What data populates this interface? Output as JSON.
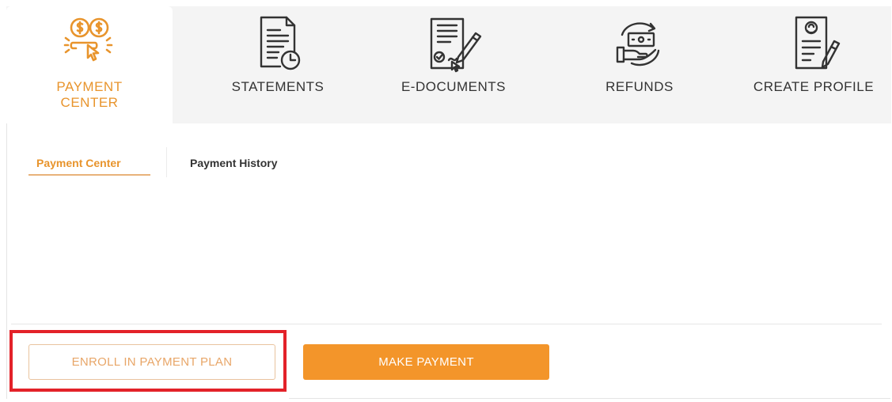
{
  "tabs": [
    {
      "id": "payment-center",
      "label_line1": "PAYMENT",
      "label_line2": "CENTER",
      "icon": "coin-hand-icon",
      "active": true
    },
    {
      "id": "statements",
      "label": "STATEMENTS",
      "icon": "document-clock-icon"
    },
    {
      "id": "e-documents",
      "label": "E-DOCUMENTS",
      "icon": "signed-document-icon"
    },
    {
      "id": "refunds",
      "label": "REFUNDS",
      "icon": "cash-hand-icon"
    },
    {
      "id": "create-profile",
      "label": "CREATE PROFILE",
      "icon": "profile-edit-icon"
    }
  ],
  "subtabs": [
    {
      "label": "Payment Center",
      "active": true
    },
    {
      "label": "Payment History",
      "active": false
    }
  ],
  "actions": {
    "enroll_label": "ENROLL IN PAYMENT PLAN",
    "pay_label": "MAKE PAYMENT"
  },
  "colors": {
    "accent": "#f3952a",
    "accent_text": "#e8942c",
    "highlight": "#e32229"
  }
}
